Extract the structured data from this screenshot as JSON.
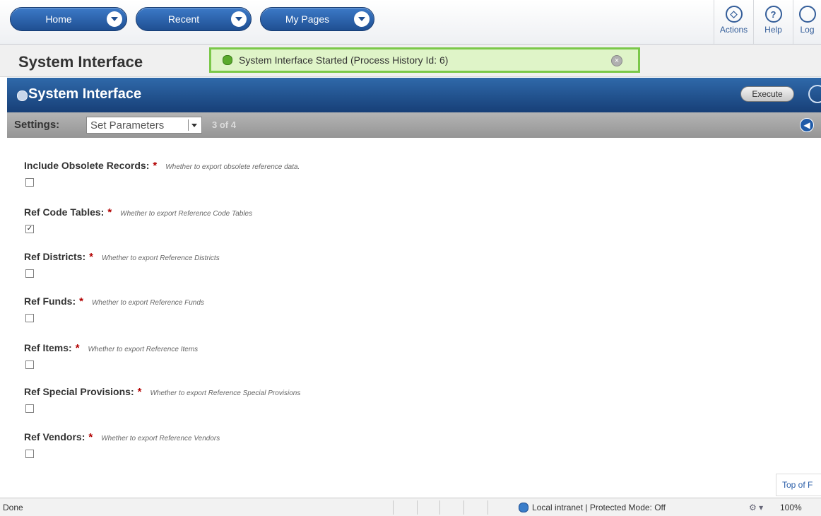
{
  "nav": {
    "home": "Home",
    "recent": "Recent",
    "my_pages": "My Pages",
    "actions": "Actions",
    "help": "Help",
    "logout": "Log"
  },
  "title": "System Interface",
  "notice": "System Interface Started (Process History Id: 6)",
  "section": {
    "title": "System Interface",
    "execute": "Execute"
  },
  "settings": {
    "label": "Settings:",
    "selected": "Set Parameters",
    "steps": "3 of 4"
  },
  "params": [
    {
      "label": "Include Obsolete Records:",
      "desc": "Whether to export obsolete reference data.",
      "checked": false
    },
    {
      "label": "Ref Code Tables:",
      "desc": "Whether to export Reference Code Tables",
      "checked": true
    },
    {
      "label": "Ref Districts:",
      "desc": "Whether to export Reference Districts",
      "checked": false
    },
    {
      "label": "Ref Funds:",
      "desc": "Whether to export Reference Funds",
      "checked": false
    },
    {
      "label": "Ref Items:",
      "desc": "Whether to export Reference Items",
      "checked": false
    },
    {
      "label": "Ref Special Provisions:",
      "desc": "Whether to export Reference Special Provisions",
      "checked": false
    },
    {
      "label": "Ref Vendors:",
      "desc": "Whether to export Reference Vendors",
      "checked": false
    }
  ],
  "top_of_page": "Top of F",
  "status": {
    "done": "Done",
    "zone": "Local intranet | Protected Mode: Off",
    "zoom": "100%"
  }
}
